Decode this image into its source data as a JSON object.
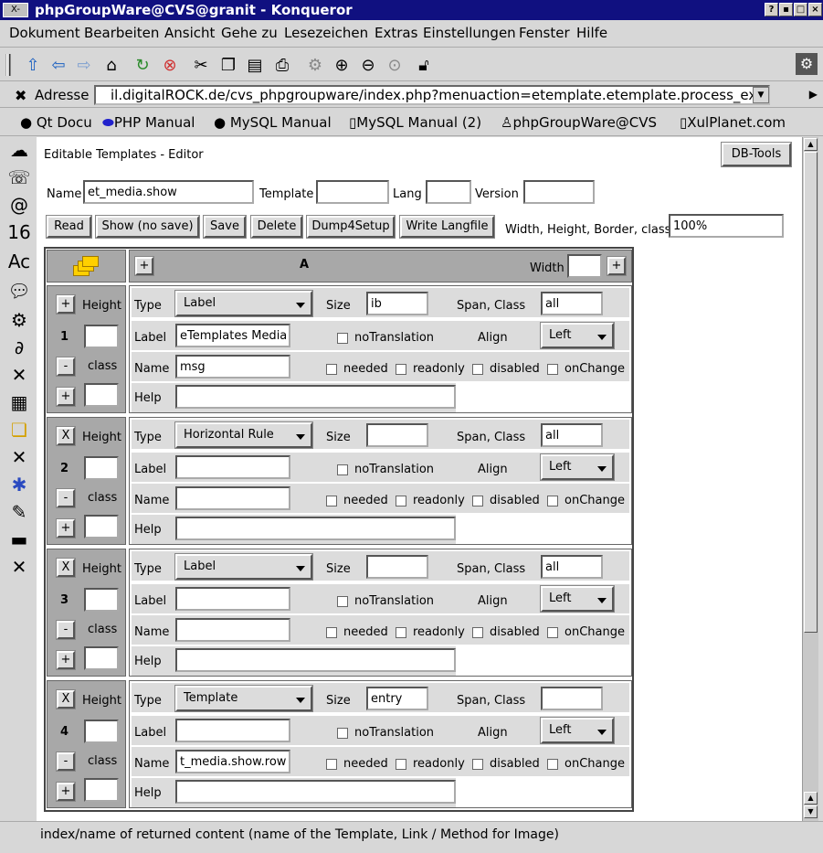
{
  "window": {
    "title": "phpGroupWare@CVS@granit - Konqueror",
    "sysmenu": "X-",
    "buttons": [
      "?",
      "▪",
      "□",
      "×"
    ]
  },
  "menubar": [
    "Dokument",
    "Bearbeiten",
    "Ansicht",
    "Gehe zu",
    "Lesezeichen",
    "Extras",
    "Einstellungen",
    "Fenster",
    "Hilfe"
  ],
  "address": {
    "label": "Adresse",
    "url": "il.digitalROCK.de/cvs_phpgroupware/index.php?menuaction=etemplate.etemplate.process_exec"
  },
  "bookmarks": [
    "Qt Docu",
    "PHP Manual",
    "MySQL Manual",
    "MySQL Manual (2)",
    "phpGroupWare@CVS",
    "XulPlanet.com"
  ],
  "editor": {
    "title": "Editable Templates - Editor",
    "dbtools": "DB-Tools",
    "name_label": "Name",
    "name_value": "et_media.show",
    "template_label": "Template",
    "template_value": "",
    "lang_label": "Lang",
    "lang_value": "",
    "version_label": "Version",
    "version_value": "",
    "buttons": {
      "read": "Read",
      "show": "Show (no save)",
      "save": "Save",
      "delete": "Delete",
      "dump": "Dump4Setup",
      "langfile": "Write Langfile"
    },
    "whbc_label": "Width, Height, Border, class",
    "whbc_value": "100%",
    "col_header": "A",
    "width_label": "Width",
    "width_value": "",
    "plus": "+",
    "minus": "-",
    "x": "X",
    "labels": {
      "height": "Height",
      "class": "class",
      "type": "Type",
      "size": "Size",
      "span": "Span, Class",
      "label": "Label",
      "notrans": "noTranslation",
      "align": "Align",
      "name": "Name",
      "needed": "needed",
      "readonly": "readonly",
      "disabled": "disabled",
      "onchange": "onChange",
      "help": "Help"
    },
    "rows": [
      {
        "num": "1",
        "top_btn": "+",
        "type": "Label",
        "size": "ib",
        "span": "all",
        "label": "eTemplates MediaD",
        "align": "Left",
        "name": "msg",
        "help": ""
      },
      {
        "num": "2",
        "top_btn": "X",
        "type": "Horizontal Rule",
        "size": "",
        "span": "all",
        "label": "",
        "align": "Left",
        "name": "",
        "help": ""
      },
      {
        "num": "3",
        "top_btn": "X",
        "type": "Label",
        "size": "",
        "span": "all",
        "label": "",
        "align": "Left",
        "name": "",
        "help": ""
      },
      {
        "num": "4",
        "top_btn": "X",
        "type": "Template",
        "size": "entry",
        "span": "",
        "label": "",
        "align": "Left",
        "name": "t_media.show.rows",
        "help": ""
      }
    ]
  },
  "status": "index/name of returned content (name of the Template, Link / Method for Image)"
}
